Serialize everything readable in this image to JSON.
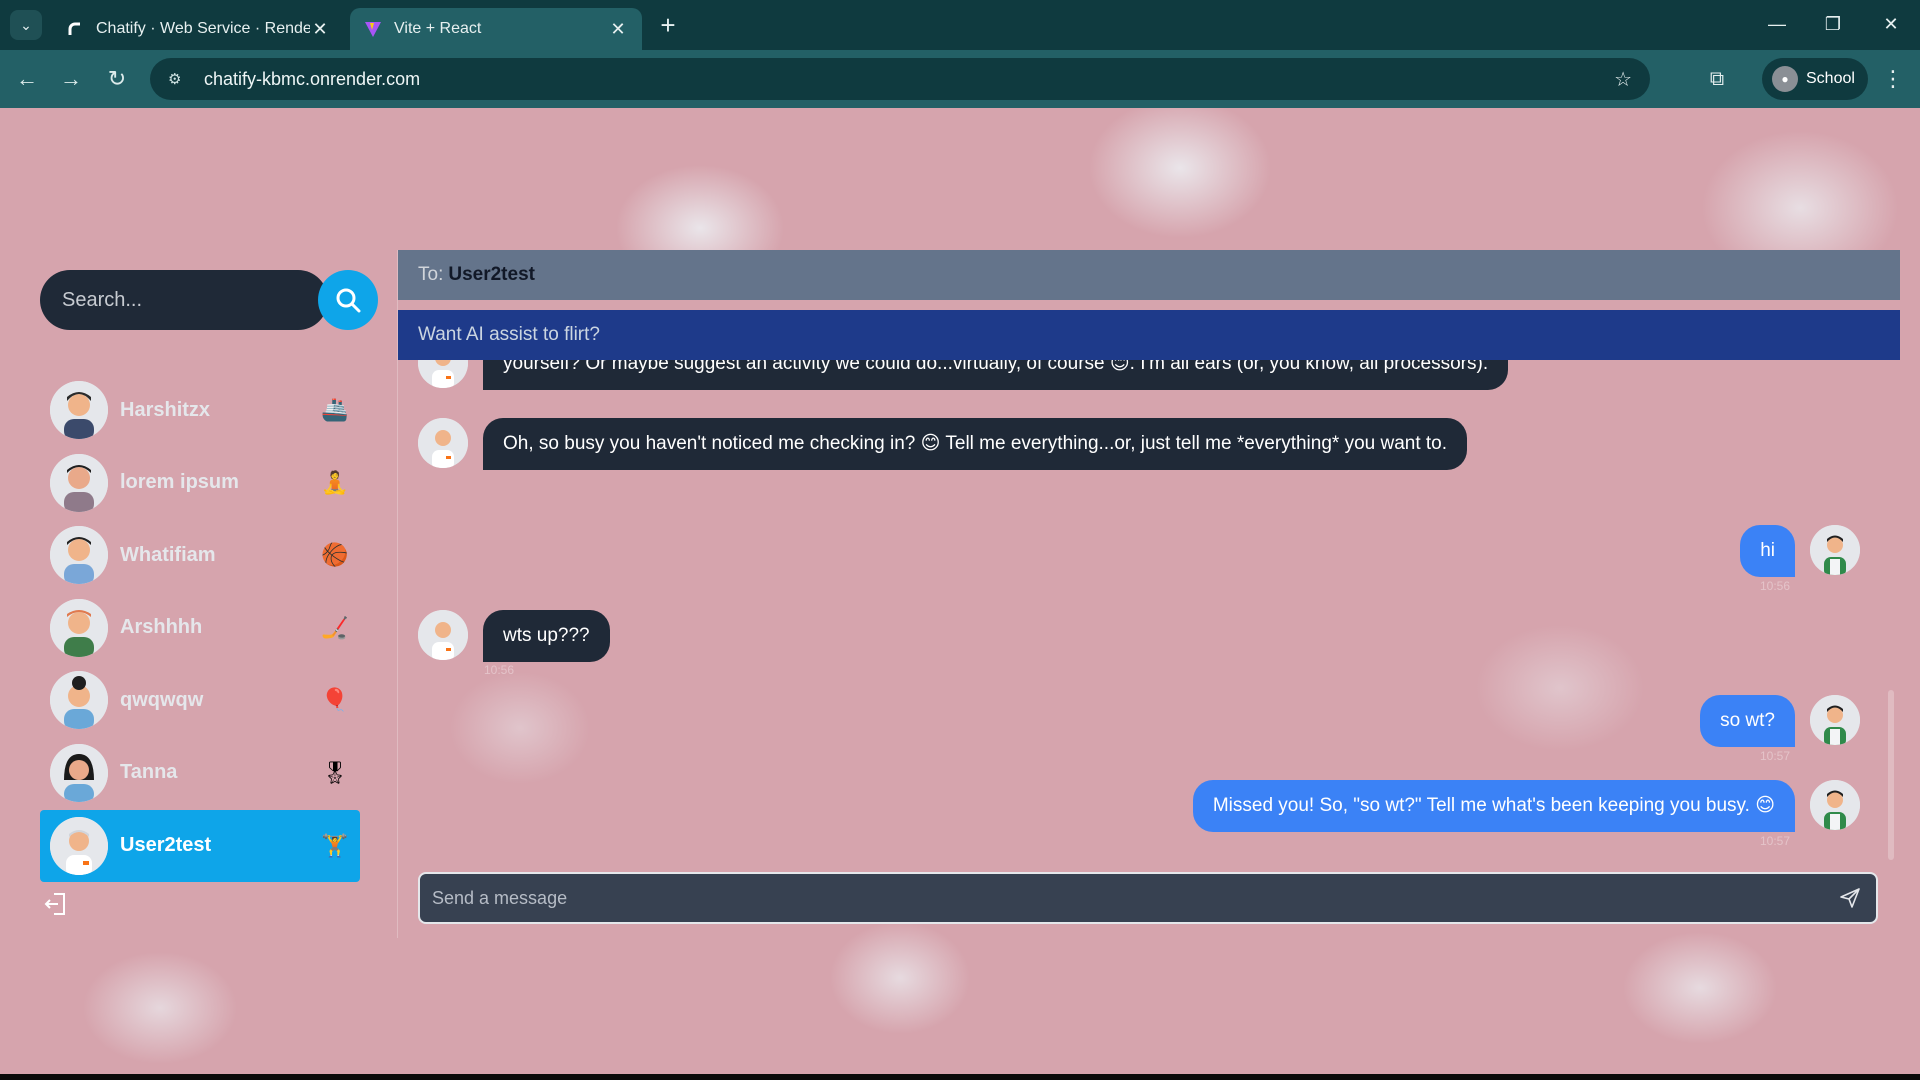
{
  "browser": {
    "tabs": [
      {
        "title": "Chatify · Web Service · Render",
        "active": false
      },
      {
        "title": "Vite + React",
        "active": true
      }
    ],
    "url": "chatify-kbmc.onrender.com",
    "profile_label": "School"
  },
  "sidebar": {
    "search_placeholder": "Search...",
    "contacts": [
      {
        "name": "Harshitzx",
        "emoji": "🚢"
      },
      {
        "name": "lorem ipsum",
        "emoji": "🧘"
      },
      {
        "name": "Whatifiam",
        "emoji": "🏀"
      },
      {
        "name": "Arshhhh",
        "emoji": "🏒"
      },
      {
        "name": "qwqwqw",
        "emoji": "🎈"
      },
      {
        "name": "Tanna",
        "emoji": "🎖"
      },
      {
        "name": "User2test",
        "emoji": "🏋",
        "selected": true
      }
    ]
  },
  "chat": {
    "to_label": "To:",
    "to_name": "User2test",
    "ai_prompt": "Want AI assist to flirt?",
    "messages": [
      {
        "side": "in",
        "text": "yourself? Or maybe suggest an activity we could do...virtually, of course 😊. I'm all ears (or, you know, all processors).",
        "time": ""
      },
      {
        "side": "in",
        "text": "Oh, so busy you haven't noticed me checking in? 😊 Tell me everything...or, just tell me *everything* you want to.",
        "time": ""
      },
      {
        "side": "out",
        "text": "hi",
        "time": "10:56"
      },
      {
        "side": "in",
        "text": "wts up???",
        "time": "10:56"
      },
      {
        "side": "out",
        "text": "so wt?",
        "time": "10:57"
      },
      {
        "side": "out",
        "text": "Missed you! So, \"so wt?\" Tell me what's been keeping you busy. 😊",
        "time": "10:57"
      }
    ],
    "composer_placeholder": "Send a message"
  },
  "colors": {
    "accent": "#0ea5e9",
    "outgoing_bubble": "#3b82f6",
    "incoming_bubble": "#1f2937",
    "ai_bar": "#1e3a8a",
    "header": "#64748b"
  }
}
